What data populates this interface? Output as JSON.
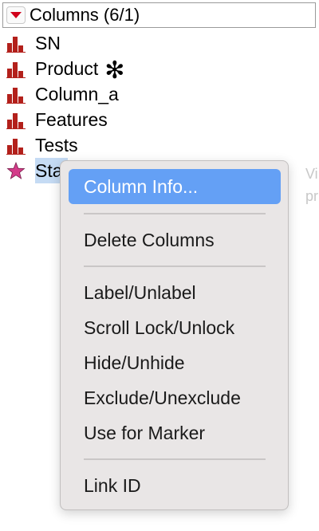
{
  "header": {
    "title": "Columns (6/1)",
    "disclosure_icon": "triangle-down-icon",
    "accent_color": "#d0021b"
  },
  "columns": [
    {
      "label": "SN",
      "icon": "continuous-bar-chart-icon",
      "icon_color": "#b3201b"
    },
    {
      "label": "Product",
      "icon": "continuous-bar-chart-icon",
      "icon_color": "#b3201b",
      "marker": "✻"
    },
    {
      "label": "Column_a",
      "icon": "continuous-bar-chart-icon",
      "icon_color": "#b3201b"
    },
    {
      "label": "Features",
      "icon": "continuous-bar-chart-icon",
      "icon_color": "#b3201b"
    },
    {
      "label": "Tests",
      "icon": "continuous-bar-chart-icon",
      "icon_color": "#b3201b"
    },
    {
      "label": "Sta",
      "icon": "star-icon",
      "icon_color": "#d43c8a",
      "selected": true
    }
  ],
  "background_hint": {
    "line1": "Vi",
    "line2": "pr"
  },
  "context_menu": {
    "highlight_color": "#64a0f5",
    "items": [
      {
        "label": "Column Info..."
      },
      {
        "label": "Delete Columns"
      },
      {
        "label": "Label/Unlabel"
      },
      {
        "label": "Scroll Lock/Unlock"
      },
      {
        "label": "Hide/Unhide"
      },
      {
        "label": "Exclude/Unexclude"
      },
      {
        "label": "Use for Marker"
      },
      {
        "label": "Link ID"
      }
    ]
  }
}
